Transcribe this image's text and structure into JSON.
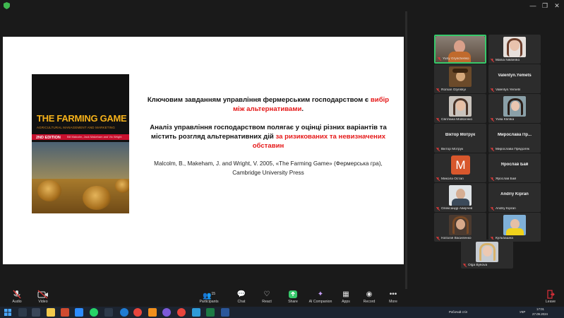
{
  "slide": {
    "book": {
      "title": "THE FARMING GAME",
      "subtitle": "AGRICULTURAL MANAGEMENT AND MARKETING",
      "edition": "2ND EDITION",
      "authors": "Bill Malcolm, Jack Makeham and Vic Wright"
    },
    "para1_prefix": "Ключовим завданням управління фермерським господарством є",
    "para1_highlight": "вибір між альтернативами",
    "para1_suffix": ".",
    "para2_prefix": "Аналіз управління господарством полягає у оцінці різних варіантів та містить розгляд альтернативних дій",
    "para2_highlight": "за ризикованих та невизначених обставин",
    "citation_line1": "Malcolm, B., Makeham, J. and Wright, V. 2005, «The Farming Game» (Фермерська гра),",
    "citation_line2": "Cambridge University Press"
  },
  "participants": [
    {
      "name": "Yuriy Gryschenko",
      "type": "video"
    },
    {
      "name": "Mariia Nikitenko",
      "type": "video"
    },
    {
      "name": "Roman Glynskyi",
      "type": "video"
    },
    {
      "name": "Valentyn.Yemets",
      "display": "Valentyn.Yemets",
      "type": "name"
    },
    {
      "name": "Світлана Мойсієнко",
      "type": "video"
    },
    {
      "name": "Yulia Klimka",
      "type": "video"
    },
    {
      "name": "Віктор Мотрук",
      "display": "Віктор Мотрук",
      "type": "name"
    },
    {
      "name": "Мирослава Прядоляк",
      "display": "Мирослава Пр...",
      "type": "name"
    },
    {
      "name": "Микола Остап",
      "type": "avatar",
      "letter": "M"
    },
    {
      "name": "Ярослав Бай",
      "display": "Ярослав Бай",
      "type": "name"
    },
    {
      "name": "Олександр Аверчев",
      "type": "video"
    },
    {
      "name": "Andriy Kipran",
      "display": "Andriy Kipran",
      "type": "name"
    },
    {
      "name": "Наталія Василенко",
      "type": "video"
    },
    {
      "name": "Кульбашна",
      "type": "video"
    },
    {
      "name": "Olga Bykova",
      "type": "video"
    }
  ],
  "toolbar": {
    "audio": "Audio",
    "video": "Video",
    "participants": "Participants",
    "participants_count": "15",
    "chat": "Chat",
    "react": "React",
    "share": "Share",
    "ai_companion": "AI Companion",
    "apps": "Apps",
    "record": "Record",
    "more": "More",
    "leave": "Leave"
  },
  "taskbar": {
    "desktop_label": "Робочий стіл",
    "language": "УКР",
    "time": "17:01",
    "date": "27.09.2024"
  },
  "colors": {
    "highlight_red": "#e51818",
    "active_speaker": "#37c96b",
    "share_green": "#37c96b",
    "leave_red": "#e0303a"
  }
}
